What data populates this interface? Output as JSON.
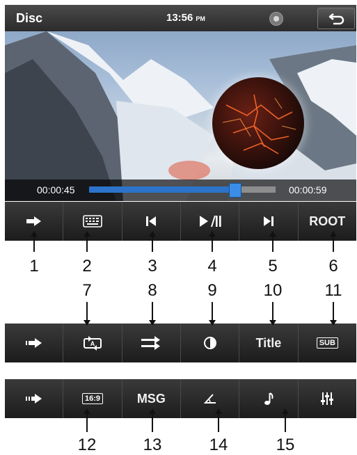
{
  "status": {
    "source": "Disc",
    "time": "13:56",
    "ampm": "PM"
  },
  "playback": {
    "elapsed": "00:00:45",
    "total": "00:00:59",
    "progress": 0.78
  },
  "toolbar1": [
    {
      "icon": "arrow-right-icon"
    },
    {
      "icon": "keyboard-icon"
    },
    {
      "icon": "previous-track-icon"
    },
    {
      "icon": "play-pause-icon"
    },
    {
      "icon": "next-track-icon"
    },
    {
      "label": "ROOT"
    }
  ],
  "toolbar2": [
    {
      "icon": "double-arrow-right-icon"
    },
    {
      "icon": "repeat-a-icon",
      "badge": "A"
    },
    {
      "icon": "shuffle-icon"
    },
    {
      "icon": "contrast-icon"
    },
    {
      "label": "Title"
    },
    {
      "label": "SUB"
    }
  ],
  "toolbar3": [
    {
      "icon": "triple-arrow-right-icon"
    },
    {
      "label": "16:9"
    },
    {
      "label": "MSG"
    },
    {
      "icon": "angle-icon"
    },
    {
      "icon": "music-note-icon"
    },
    {
      "icon": "equalizer-icon"
    }
  ],
  "callouts": {
    "n1": "1",
    "n2": "2",
    "n3": "3",
    "n4": "4",
    "n5": "5",
    "n6": "6",
    "n7": "7",
    "n8": "8",
    "n9": "9",
    "n10": "10",
    "n11": "11",
    "n12": "12",
    "n13": "13",
    "n14": "14",
    "n15": "15"
  }
}
